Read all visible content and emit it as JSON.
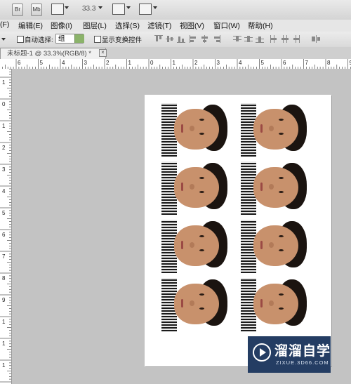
{
  "appbar": {
    "br_label": "Br",
    "mb_label": "Mb",
    "zoom": "33.3"
  },
  "menu": {
    "items": [
      "(F)",
      "编辑(E)",
      "图像(I)",
      "图层(L)",
      "选择(S)",
      "滤镜(T)",
      "视图(V)",
      "窗口(W)",
      "帮助(H)"
    ]
  },
  "options": {
    "auto_select_label": "自动选择:",
    "auto_select_value": "组",
    "show_transform_label": "显示变换控件"
  },
  "document": {
    "tab_label": "未标题-1 @ 33.3%(RGB/8) *",
    "close_glyph": "×"
  },
  "rulers": {
    "top": [
      "6",
      "5",
      "4",
      "3",
      "2",
      "1",
      "0",
      "1",
      "2",
      "3",
      "4",
      "5",
      "6",
      "7",
      "8",
      "9"
    ],
    "left": [
      "1",
      "0",
      "1",
      "2",
      "3",
      "4",
      "5",
      "6",
      "7",
      "8",
      "9",
      "1",
      "1",
      "1"
    ]
  },
  "watermark": {
    "title": "溜溜自学",
    "url": "ZIXUE.3D66.COM"
  },
  "photos": {
    "count": 8,
    "columns": 2,
    "rows": 4
  }
}
